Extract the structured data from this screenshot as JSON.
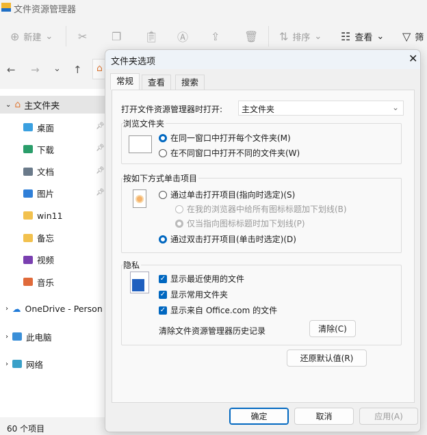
{
  "window": {
    "title": "文件资源管理器"
  },
  "toolbar": {
    "new": "新建",
    "sort": "排序",
    "view": "查看",
    "filter": "筛"
  },
  "sidebar": {
    "home": "主文件夹",
    "items": [
      {
        "label": "桌面",
        "icon": "desktop-icon",
        "color": "#3aa0e0",
        "pinned": true
      },
      {
        "label": "下载",
        "icon": "download-icon",
        "color": "#2a9d6a",
        "pinned": true
      },
      {
        "label": "文档",
        "icon": "document-icon",
        "color": "#6a7a8a",
        "pinned": true
      },
      {
        "label": "图片",
        "icon": "pictures-icon",
        "color": "#2f7fd8",
        "pinned": true
      },
      {
        "label": "win11",
        "icon": "folder-icon",
        "color": "#f2c14e",
        "pinned": false
      },
      {
        "label": "备忘",
        "icon": "folder-icon",
        "color": "#f2c14e",
        "pinned": false
      },
      {
        "label": "视频",
        "icon": "video-icon",
        "color": "#7a3fb0",
        "pinned": false
      },
      {
        "label": "音乐",
        "icon": "music-icon",
        "color": "#e06a3a",
        "pinned": false
      }
    ],
    "onedrive": "OneDrive - Person",
    "thispc": "此电脑",
    "network": "网络"
  },
  "status": {
    "count": "60 个项目"
  },
  "dialog": {
    "title": "文件夹选项",
    "tabs": [
      "常规",
      "查看",
      "搜索"
    ],
    "open_label": "打开文件资源管理器时打开:",
    "open_value": "主文件夹",
    "browse": {
      "label": "浏览文件夹",
      "options": [
        "在同一窗口中打开每个文件夹(M)",
        "在不同窗口中打开不同的文件夹(W)"
      ],
      "selected": 0
    },
    "click": {
      "label": "按如下方式单击项目",
      "single": "通过单击打开项目(指向时选定)(S)",
      "sub1": "在我的浏览器中给所有图标标题加下划线(B)",
      "sub2": "仅当指向图标标题时加下划线(P)",
      "double": "通过双击打开项目(单击时选定)(D)"
    },
    "privacy": {
      "label": "隐私",
      "checks": [
        "显示最近使用的文件",
        "显示常用文件夹",
        "显示来自 Office.com 的文件"
      ],
      "clear_label": "清除文件资源管理器历史记录",
      "clear_button": "清除(C)"
    },
    "restore": "还原默认值(R)",
    "ok": "确定",
    "cancel": "取消",
    "apply": "应用(A)"
  },
  "colors": {
    "accent": "#0067c0"
  }
}
